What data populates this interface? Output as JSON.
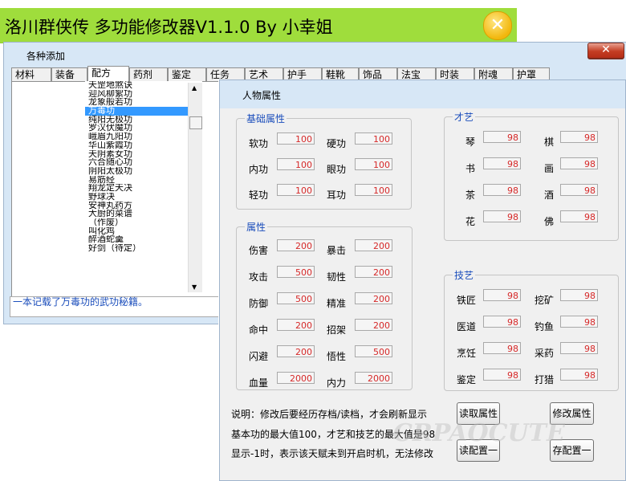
{
  "app": {
    "title": "洛川群侠传 多功能修改器V1.1.0 By 小幸姐",
    "close_glyph": "✕"
  },
  "main_window": {
    "title": "各种添加",
    "close_glyph": "✕",
    "tabs": [
      "材料",
      "装备",
      "配方",
      "药剂",
      "鉴定",
      "任务",
      "艺术",
      "护手",
      "鞋靴",
      "饰品",
      "法宝",
      "时装",
      "附魂",
      "护罩"
    ],
    "selected_tab": "配方",
    "list_items": [
      "天罡地煞诀",
      "迎风柳絮功",
      "龙象般若功",
      "万毒功",
      "纯阳无极功",
      "罗汉伏魔功",
      "峨眉九阳功",
      "华山紫霞功",
      "天阴素女功",
      "六合随心功",
      "阴阳太极功",
      "易筋经",
      "翔龙定天决",
      "野球决",
      "安神丸药方",
      "大厨的菜谱",
      "（作废）",
      "叫化鸡",
      "醉酒蛇羹",
      "好剑（待定）"
    ],
    "selected_item": "万毒功",
    "status": "一本记载了万毒功的武功秘籍。"
  },
  "attr_window": {
    "title": "人物属性",
    "close_glyph": "✕",
    "basic": {
      "title": "基础属性",
      "rows": [
        {
          "l1": "软功",
          "v1": "100",
          "l2": "硬功",
          "v2": "100"
        },
        {
          "l1": "内功",
          "v1": "100",
          "l2": "眼功",
          "v2": "100"
        },
        {
          "l1": "轻功",
          "v1": "100",
          "l2": "耳功",
          "v2": "100"
        }
      ]
    },
    "props": {
      "title": "属性",
      "rows": [
        {
          "l1": "伤害",
          "v1": "200",
          "l2": "暴击",
          "v2": "200"
        },
        {
          "l1": "攻击",
          "v1": "500",
          "l2": "韧性",
          "v2": "200"
        },
        {
          "l1": "防御",
          "v1": "500",
          "l2": "精准",
          "v2": "200"
        },
        {
          "l1": "命中",
          "v1": "200",
          "l2": "招架",
          "v2": "200"
        },
        {
          "l1": "闪避",
          "v1": "200",
          "l2": "悟性",
          "v2": "500"
        },
        {
          "l1": "血量",
          "v1": "2000",
          "l2": "内力",
          "v2": "2000"
        }
      ]
    },
    "talent": {
      "title": "才艺",
      "rows": [
        {
          "l1": "琴",
          "v1": "98",
          "l2": "棋",
          "v2": "98"
        },
        {
          "l1": "书",
          "v1": "98",
          "l2": "画",
          "v2": "98"
        },
        {
          "l1": "茶",
          "v1": "98",
          "l2": "酒",
          "v2": "98"
        },
        {
          "l1": "花",
          "v1": "98",
          "l2": "佛",
          "v2": "98"
        }
      ]
    },
    "skill": {
      "title": "技艺",
      "rows": [
        {
          "l1": "铁匠",
          "v1": "98",
          "l2": "挖矿",
          "v2": "98"
        },
        {
          "l1": "医道",
          "v1": "98",
          "l2": "钓鱼",
          "v2": "98"
        },
        {
          "l1": "烹饪",
          "v1": "98",
          "l2": "采药",
          "v2": "98"
        },
        {
          "l1": "鉴定",
          "v1": "98",
          "l2": "打猎",
          "v2": "98"
        }
      ]
    },
    "notes": [
      "说明：修改后要经历存档/读档，才会刷新显示",
      "基本功的最大值100，才艺和技艺的最大值是98",
      "显示-1时，表示该天赋未到开启时机，无法修改"
    ],
    "buttons": {
      "read_attr": "读取属性",
      "modify_attr": "修改属性",
      "read_config": "读配置一",
      "save_config": "存配置一"
    }
  },
  "watermark": "CRPAOCUTE",
  "colors": {
    "title_green": "#9fdd3c",
    "value_red": "#d62828",
    "group_title_blue": "#1a4dbb",
    "window_blue": "#d7e7f6",
    "selection": "#3399ff"
  }
}
